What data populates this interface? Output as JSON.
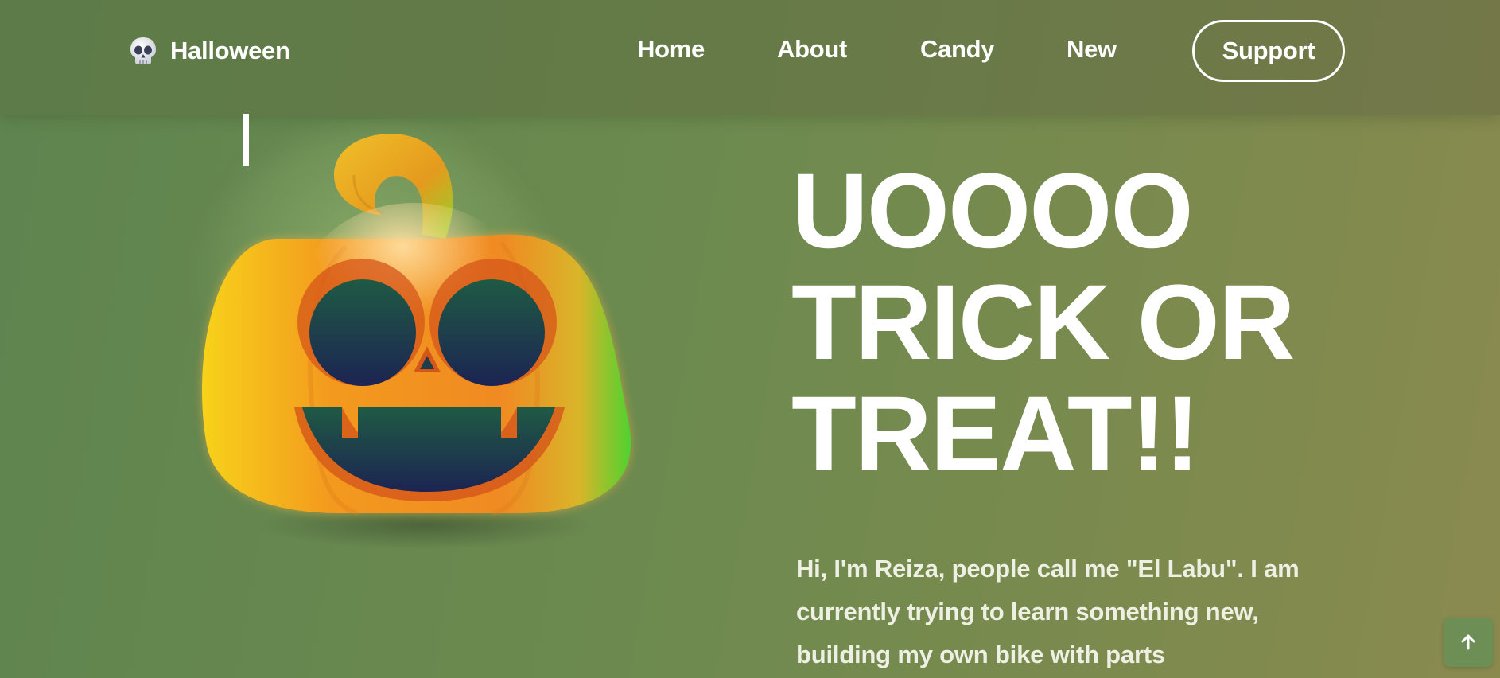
{
  "header": {
    "brand": {
      "icon": "skull-icon",
      "label": "Halloween"
    },
    "nav": [
      {
        "label": "Home"
      },
      {
        "label": "About"
      },
      {
        "label": "Candy"
      },
      {
        "label": "New"
      }
    ],
    "support_label": "Support"
  },
  "hero": {
    "title_lines": [
      "UOOOO",
      "TRICK OR",
      "TREAT!!"
    ],
    "description": "Hi, I'm Reiza, people call me \"El Labu\". I am currently trying to learn something new, building my own bike with parts",
    "image": "jack-o-lantern-pumpkin"
  },
  "back_to_top_icon": "arrow-up-icon",
  "colors": {
    "background": "#6c8a4f",
    "header": "#667a47",
    "text": "#ffffff",
    "pumpkin_orange": "#f39a1e",
    "pumpkin_green": "#57d12f",
    "pumpkin_face": "#1e2a4a"
  }
}
